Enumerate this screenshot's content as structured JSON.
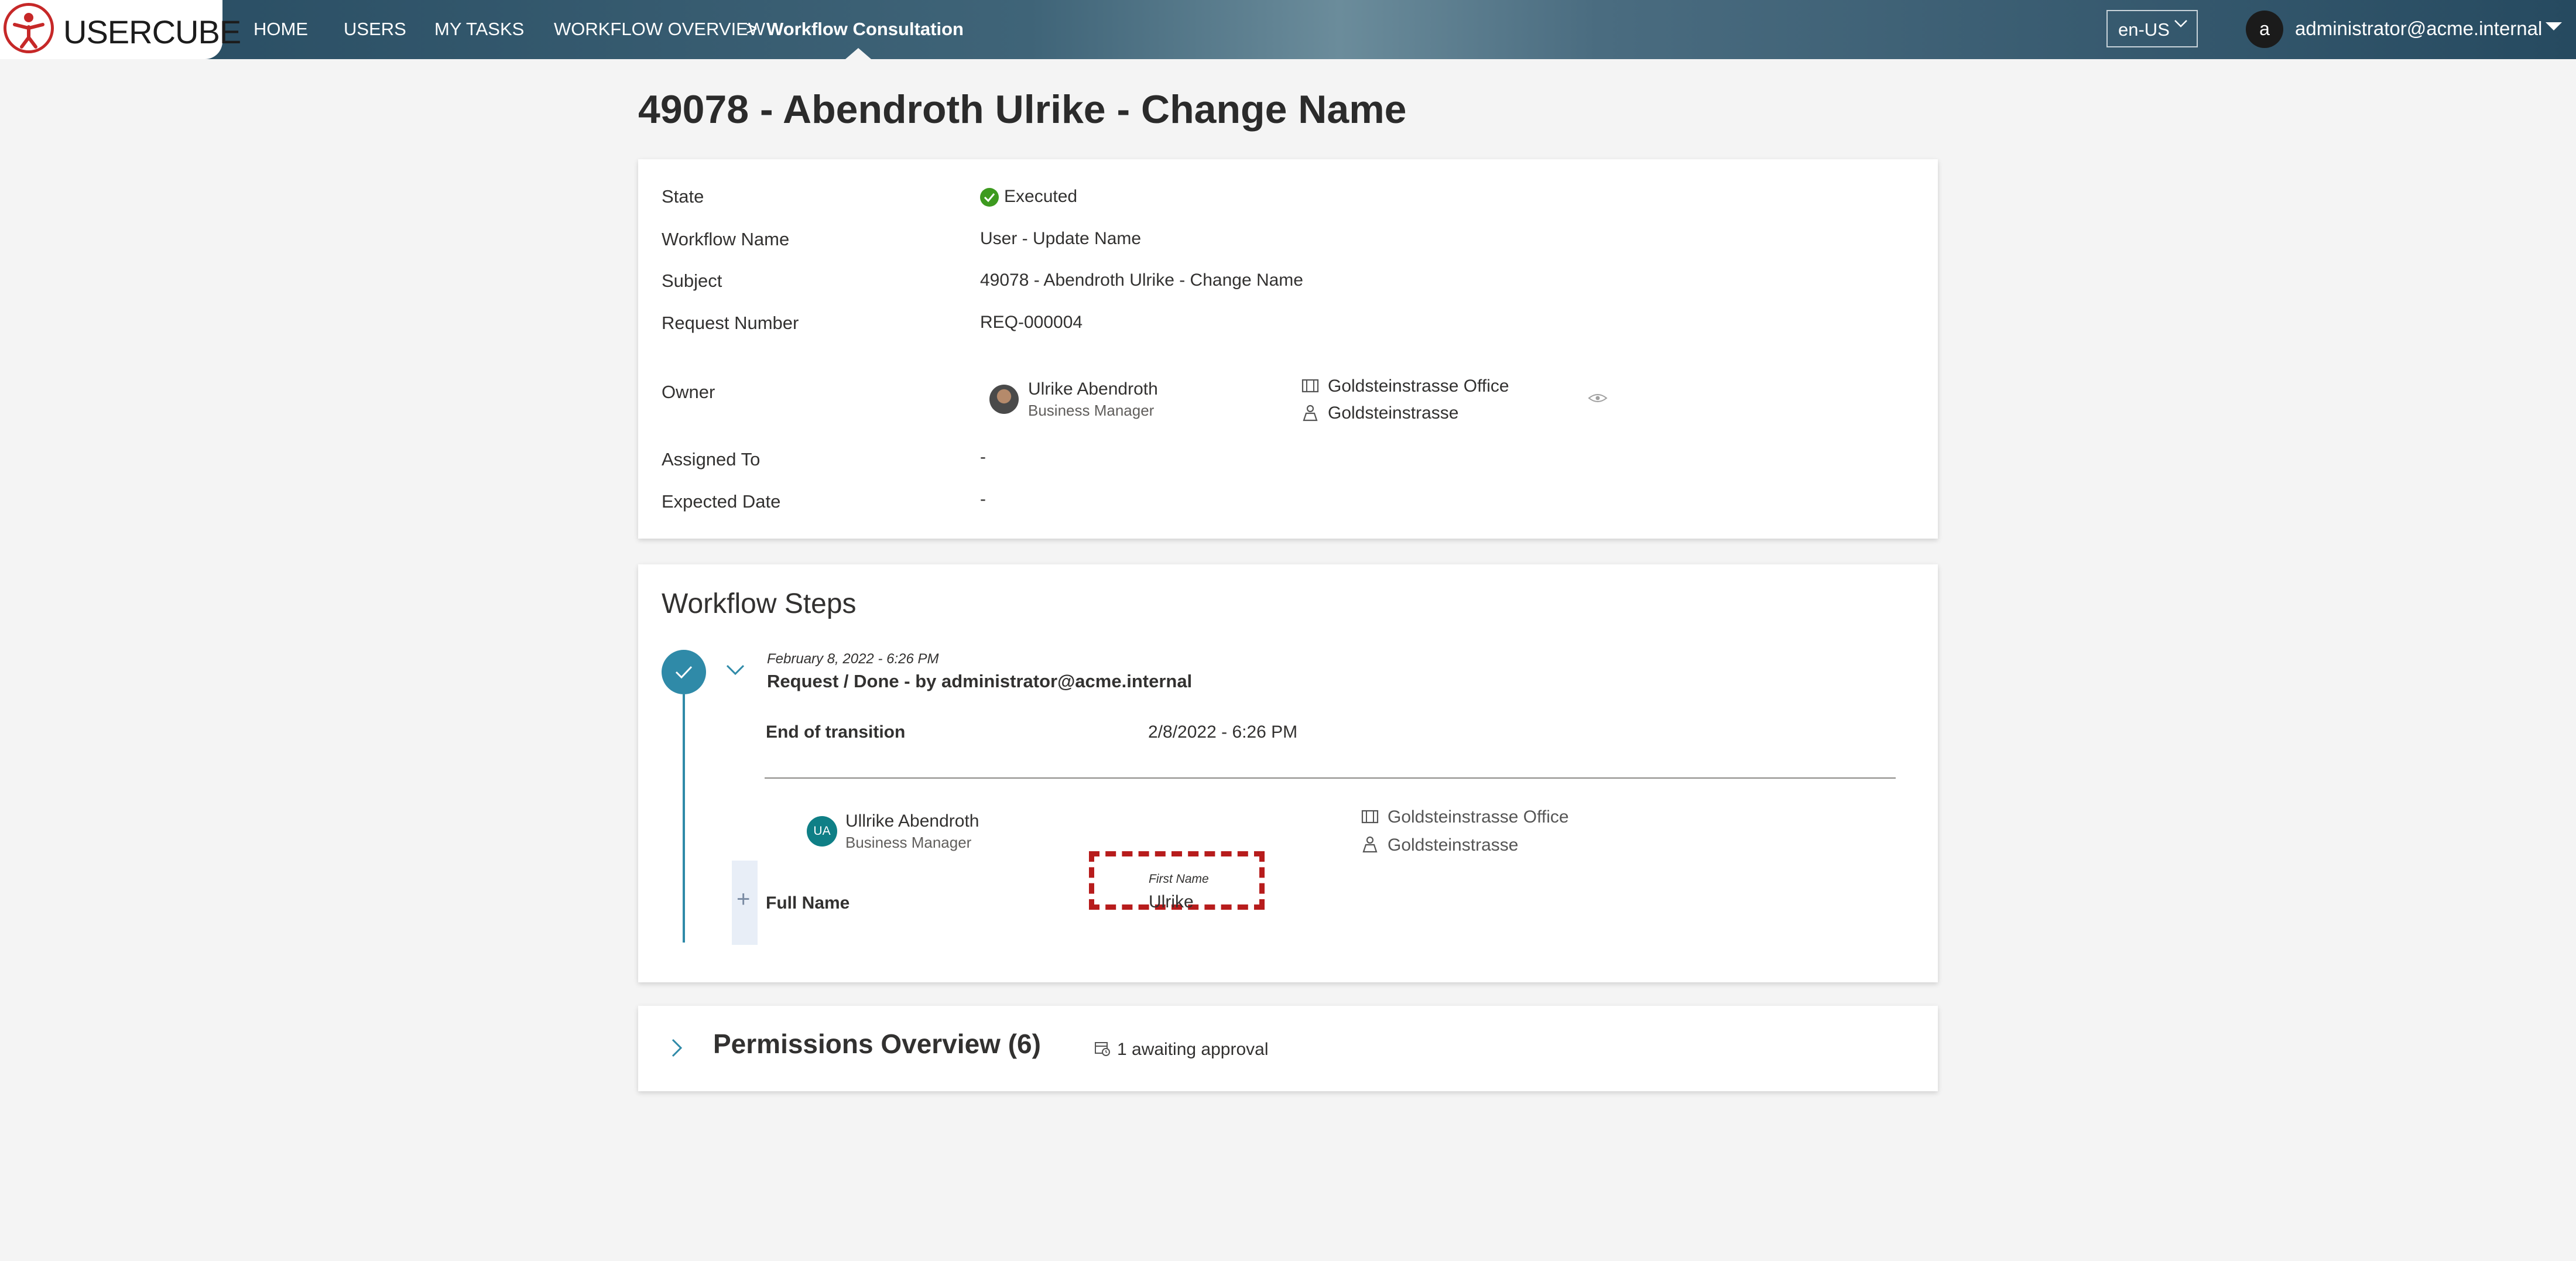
{
  "app": {
    "logo_text": "USERCUBE"
  },
  "nav": {
    "home": "HOME",
    "users": "USERS",
    "my_tasks": "MY TASKS",
    "workflow_overview": "WORKFLOW OVERVIEW",
    "separator": ">",
    "current": "Workflow Consultation"
  },
  "header": {
    "language": "en-US",
    "avatar_letter": "a",
    "user_email": "administrator@acme.internal"
  },
  "page": {
    "title": "49078 - Abendroth Ulrike - Change Name"
  },
  "details": {
    "state_label": "State",
    "state_value": "Executed",
    "workflow_name_label": "Workflow Name",
    "workflow_name_value": "User - Update Name",
    "subject_label": "Subject",
    "subject_value": "49078 - Abendroth Ulrike - Change Name",
    "request_number_label": "Request Number",
    "request_number_value": "REQ-000004",
    "owner_label": "Owner",
    "owner_name": "Ulrike Abendroth",
    "owner_title": "Business Manager",
    "owner_office": "Goldsteinstrasse Office",
    "owner_location": "Goldsteinstrasse",
    "assigned_to_label": "Assigned To",
    "assigned_to_value": "-",
    "expected_date_label": "Expected Date",
    "expected_date_value": "-"
  },
  "workflow_steps": {
    "title": "Workflow Steps",
    "step": {
      "date": "February 8, 2022  - 6:26 PM",
      "action": "Request / Done - by administrator@acme.internal",
      "end_of_transition_label": "End of transition",
      "end_of_transition_value": "2/8/2022  - 6:26 PM",
      "person_initials": "UA",
      "person_name": "Ullrike Abendroth",
      "person_title": "Business Manager",
      "person_office": "Goldsteinstrasse Office",
      "person_location": "Goldsteinstrasse",
      "field_label": "Full Name",
      "first_name_label": "First Name",
      "first_name_value": "Ulrike",
      "expand_symbol": "+"
    }
  },
  "permissions": {
    "title": "Permissions Overview (6)",
    "awaiting": "1 awaiting approval"
  },
  "colors": {
    "topbar": "#264a60",
    "accent": "#2f8aa8",
    "success": "#3d9a1f",
    "highlight": "#b71c1c",
    "badge": "#0f7f86"
  }
}
